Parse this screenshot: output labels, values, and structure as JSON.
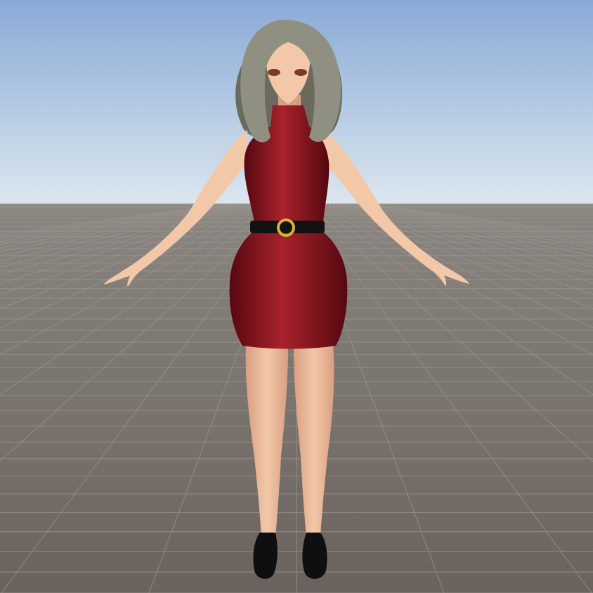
{
  "scene": {
    "colors": {
      "sky_top": "#8aaad6",
      "sky_mid": "#bcd0e6",
      "sky_horizon": "#dfe8ef",
      "ground_far": "#8a8580",
      "ground_near": "#6a625d",
      "grid_line": "#9a948f",
      "dress": "#7a0d14",
      "dress_highlight": "#a8222c",
      "dress_shadow": "#560810",
      "skin": "#f2c8a8",
      "skin_shadow": "#d99f82",
      "hair": "#8f9081",
      "hair_shadow": "#6a6b5e",
      "belt": "#121212",
      "buckle": "#d9b233",
      "shoes": "#0f0f10",
      "eyes": "#7a3a2e"
    }
  }
}
